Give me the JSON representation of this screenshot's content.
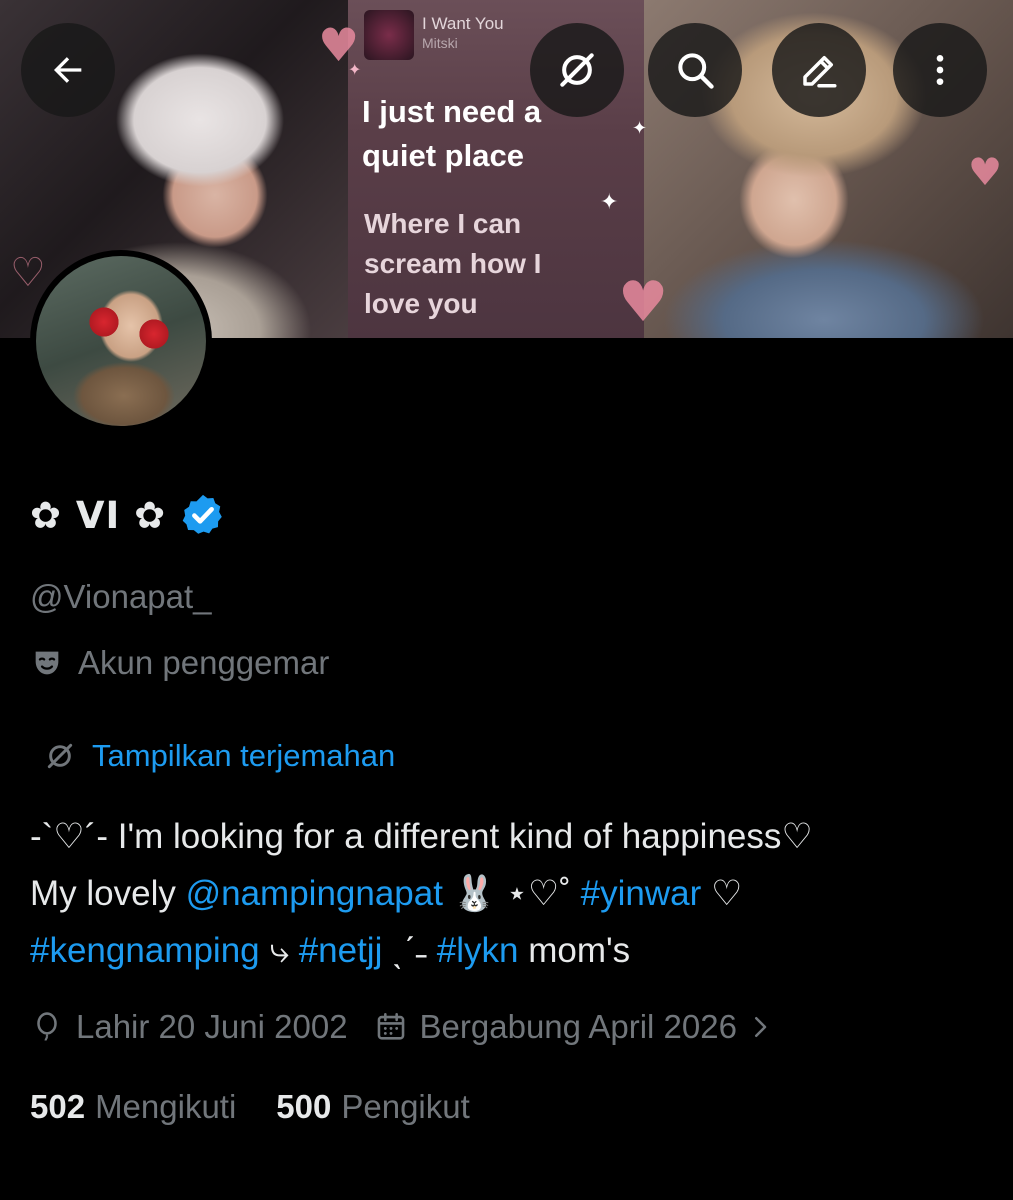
{
  "banner": {
    "song_title": "I Want You",
    "song_artist": "Mitski",
    "lyric_line1": "I just need a",
    "lyric_line2": "quiet place",
    "lyric_line3": "Where I can",
    "lyric_line4": "scream how I",
    "lyric_line5": "love you"
  },
  "topbar": {
    "back_icon": "back-arrow-icon",
    "translate_icon": "translate-icon",
    "search_icon": "search-icon",
    "edit_icon": "edit-icon",
    "more_icon": "more-vertical-icon"
  },
  "profile": {
    "name": "✿ VI ✿",
    "verified": true,
    "handle": "@Vionapat_",
    "account_type": "Akun penggemar",
    "translate_label": "Tampilkan terjemahan",
    "bio": {
      "line1": "-`♡´- I'm looking for a different kind of happiness♡",
      "line2_text1": "My lovely ",
      "line2_mention": "@nampingnapat",
      "line2_text2": " 🐰  ⋆♡˚ ",
      "line2_hashtag": "#yinwar",
      "line2_text3": " ♡",
      "line3_hashtag1": "#kengnamping",
      "line3_text1": " ⤷ ",
      "line3_hashtag2": "#netjj",
      "line3_text2": " ˎˊ˗ ",
      "line3_hashtag3": "#lykn",
      "line3_text3": " mom's"
    },
    "birth": "Lahir 20 Juni 2002",
    "joined": "Bergabung April 2026",
    "following_count": "502",
    "following_label": "Mengikuti",
    "followers_count": "500",
    "followers_label": "Pengikut"
  },
  "colors": {
    "background": "#000000",
    "text": "#e7e9ea",
    "muted": "#71767b",
    "accent": "#1d9bf0"
  }
}
